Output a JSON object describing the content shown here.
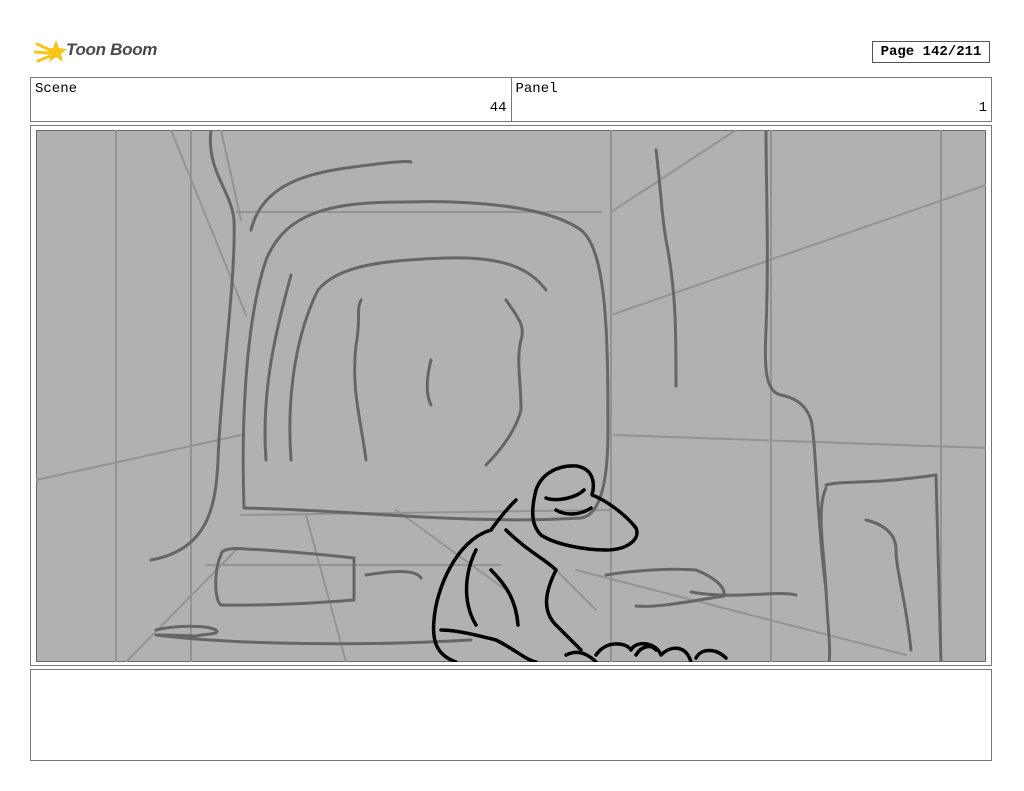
{
  "brand": {
    "name": "Toon Boom",
    "logo_icon": "comet-star-icon",
    "accent": "#f5c518"
  },
  "page": {
    "label": "Page 142/211"
  },
  "scene": {
    "label": "Scene",
    "value": "44"
  },
  "panel": {
    "label": "Panel",
    "value": "1"
  },
  "drawing": {
    "subject": "sketch",
    "background": "#b1b1b1"
  },
  "caption": {
    "text": ""
  }
}
